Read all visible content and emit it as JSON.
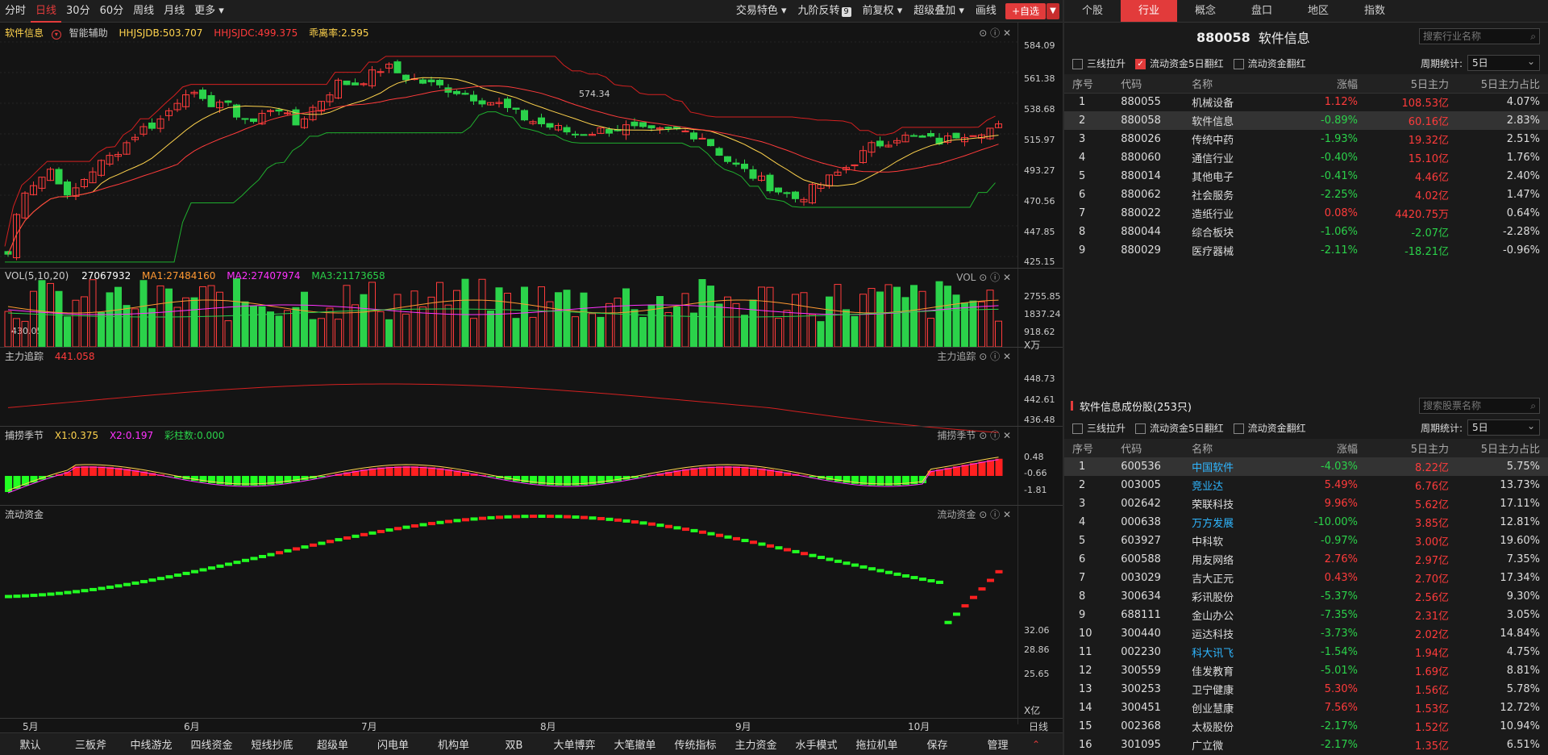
{
  "toolbar": {
    "periods": [
      "分时",
      "日线",
      "30分",
      "60分",
      "周线",
      "月线",
      "更多"
    ],
    "trade_feature": "交易特色",
    "nine_reverse": "九阶反转",
    "nine_badge": "9",
    "forward_adj": "前复权",
    "overlay": "超级叠加",
    "draw": "画线",
    "add_watch": "+自选"
  },
  "price_panel": {
    "name": "软件信息",
    "assist": "智能辅助",
    "hhjsjdb": "HHJSJDB:503.707",
    "hhjsjdc": "HHJSJDC:499.375",
    "deviation": "乖离率:2.595",
    "y_ticks": [
      "584.09",
      "561.38",
      "538.68",
      "515.97",
      "493.27",
      "470.56",
      "447.85",
      "425.15"
    ],
    "high_label": "574.34",
    "low_label": "430.05"
  },
  "vol_panel": {
    "name": "VOL(5,10,20)",
    "value": "27067932",
    "ma1": "MA1:27484160",
    "ma2": "MA2:27407974",
    "ma3": "MA3:21173658",
    "right_name": "VOL",
    "y_ticks": [
      "2755.85",
      "1837.24",
      "918.62"
    ],
    "unit": "X万"
  },
  "main_panel": {
    "name": "主力追踪",
    "value": "441.058",
    "right_name": "主力追踪",
    "y_ticks": [
      "448.73",
      "442.61",
      "436.48"
    ]
  },
  "season_panel": {
    "name": "捕捞季节",
    "x1": "X1:0.375",
    "x2": "X2:0.197",
    "bars": "彩柱数:0.000",
    "right_name": "捕捞季节",
    "y_ticks": [
      "0.48",
      "-0.66",
      "-1.81"
    ]
  },
  "flow_panel": {
    "name": "流动资金",
    "right_name": "流动资金",
    "y_ticks": [
      "32.06",
      "28.86",
      "25.65"
    ],
    "unit": "X亿"
  },
  "x_axis": {
    "months": [
      "5月",
      "6月",
      "7月",
      "8月",
      "9月",
      "10月"
    ],
    "right_label": "日线"
  },
  "bottom_tabs": [
    "默认",
    "三板斧",
    "中线游龙",
    "四线资金",
    "短线抄底",
    "超级单",
    "闪电单",
    "机构单",
    "双B",
    "大单博弈",
    "大笔撤单",
    "传统指标",
    "主力资金",
    "水手模式",
    "拖拉机单",
    "保存",
    "管理"
  ],
  "right": {
    "tabs": [
      "个股",
      "行业",
      "概念",
      "盘口",
      "地区",
      "指数"
    ],
    "code": "880058",
    "name": "软件信息",
    "search_industry": "搜索行业名称",
    "filters": [
      "三线拉升",
      "流动资金5日翻红",
      "流动资金翻红"
    ],
    "period_label": "周期统计:",
    "period_value": "5日",
    "columns": [
      "序号",
      "代码",
      "名称",
      "涨幅",
      "5日主力",
      "5日主力占比"
    ],
    "industries": [
      {
        "no": "1",
        "code": "880055",
        "name": "机械设备",
        "chg": "1.12%",
        "main": "108.53亿",
        "ratio": "4.07%",
        "c": "red",
        "m": "red"
      },
      {
        "no": "2",
        "code": "880058",
        "name": "软件信息",
        "chg": "-0.89%",
        "main": "60.16亿",
        "ratio": "2.83%",
        "c": "green",
        "m": "red"
      },
      {
        "no": "3",
        "code": "880026",
        "name": "传统中药",
        "chg": "-1.93%",
        "main": "19.32亿",
        "ratio": "2.51%",
        "c": "green",
        "m": "red"
      },
      {
        "no": "4",
        "code": "880060",
        "name": "通信行业",
        "chg": "-0.40%",
        "main": "15.10亿",
        "ratio": "1.76%",
        "c": "green",
        "m": "red"
      },
      {
        "no": "5",
        "code": "880014",
        "name": "其他电子",
        "chg": "-0.41%",
        "main": "4.46亿",
        "ratio": "2.40%",
        "c": "green",
        "m": "red"
      },
      {
        "no": "6",
        "code": "880062",
        "name": "社会服务",
        "chg": "-2.25%",
        "main": "4.02亿",
        "ratio": "1.47%",
        "c": "green",
        "m": "red"
      },
      {
        "no": "7",
        "code": "880022",
        "name": "造纸行业",
        "chg": "0.08%",
        "main": "4420.75万",
        "ratio": "0.64%",
        "c": "red",
        "m": "red"
      },
      {
        "no": "8",
        "code": "880044",
        "name": "综合板块",
        "chg": "-1.06%",
        "main": "-2.07亿",
        "ratio": "-2.28%",
        "c": "green",
        "m": "green"
      },
      {
        "no": "9",
        "code": "880029",
        "name": "医疗器械",
        "chg": "-2.11%",
        "main": "-18.21亿",
        "ratio": "-0.96%",
        "c": "green",
        "m": "green"
      }
    ],
    "stocks_title": "软件信息成份股(253只)",
    "search_stock": "搜索股票名称",
    "stocks": [
      {
        "no": "1",
        "code": "600536",
        "name": "中国软件",
        "chg": "-4.03%",
        "main": "8.22亿",
        "ratio": "5.75%",
        "c": "green",
        "n": "blue"
      },
      {
        "no": "2",
        "code": "003005",
        "name": "竞业达",
        "chg": "5.49%",
        "main": "6.76亿",
        "ratio": "13.73%",
        "c": "red",
        "n": "blue"
      },
      {
        "no": "3",
        "code": "002642",
        "name": "荣联科技",
        "chg": "9.96%",
        "main": "5.62亿",
        "ratio": "17.11%",
        "c": "red",
        "n": "white"
      },
      {
        "no": "4",
        "code": "000638",
        "name": "万方发展",
        "chg": "-10.00%",
        "main": "3.85亿",
        "ratio": "12.81%",
        "c": "green",
        "n": "blue"
      },
      {
        "no": "5",
        "code": "603927",
        "name": "中科软",
        "chg": "-0.97%",
        "main": "3.00亿",
        "ratio": "19.60%",
        "c": "green",
        "n": "white"
      },
      {
        "no": "6",
        "code": "600588",
        "name": "用友网络",
        "chg": "2.76%",
        "main": "2.97亿",
        "ratio": "7.35%",
        "c": "red",
        "n": "white"
      },
      {
        "no": "7",
        "code": "003029",
        "name": "吉大正元",
        "chg": "0.43%",
        "main": "2.70亿",
        "ratio": "17.34%",
        "c": "red",
        "n": "white"
      },
      {
        "no": "8",
        "code": "300634",
        "name": "彩讯股份",
        "chg": "-5.37%",
        "main": "2.56亿",
        "ratio": "9.30%",
        "c": "green",
        "n": "white"
      },
      {
        "no": "9",
        "code": "688111",
        "name": "金山办公",
        "chg": "-7.35%",
        "main": "2.31亿",
        "ratio": "3.05%",
        "c": "green",
        "n": "white"
      },
      {
        "no": "10",
        "code": "300440",
        "name": "运达科技",
        "chg": "-3.73%",
        "main": "2.02亿",
        "ratio": "14.84%",
        "c": "green",
        "n": "white"
      },
      {
        "no": "11",
        "code": "002230",
        "name": "科大讯飞",
        "chg": "-1.54%",
        "main": "1.94亿",
        "ratio": "4.75%",
        "c": "green",
        "n": "blue"
      },
      {
        "no": "12",
        "code": "300559",
        "name": "佳发教育",
        "chg": "-5.01%",
        "main": "1.69亿",
        "ratio": "8.81%",
        "c": "green",
        "n": "white"
      },
      {
        "no": "13",
        "code": "300253",
        "name": "卫宁健康",
        "chg": "5.30%",
        "main": "1.56亿",
        "ratio": "5.78%",
        "c": "red",
        "n": "white"
      },
      {
        "no": "14",
        "code": "300451",
        "name": "创业慧康",
        "chg": "7.56%",
        "main": "1.53亿",
        "ratio": "12.72%",
        "c": "red",
        "n": "white"
      },
      {
        "no": "15",
        "code": "002368",
        "name": "太极股份",
        "chg": "-2.17%",
        "main": "1.52亿",
        "ratio": "10.94%",
        "c": "green",
        "n": "white"
      },
      {
        "no": "16",
        "code": "301095",
        "name": "广立微",
        "chg": "-2.17%",
        "main": "1.35亿",
        "ratio": "6.51%",
        "c": "green",
        "n": "white"
      }
    ]
  },
  "colors": {
    "up": "#ff3b3b",
    "down": "#2bd24a",
    "accent": "#e23b3b",
    "link": "#2fb6ff"
  }
}
